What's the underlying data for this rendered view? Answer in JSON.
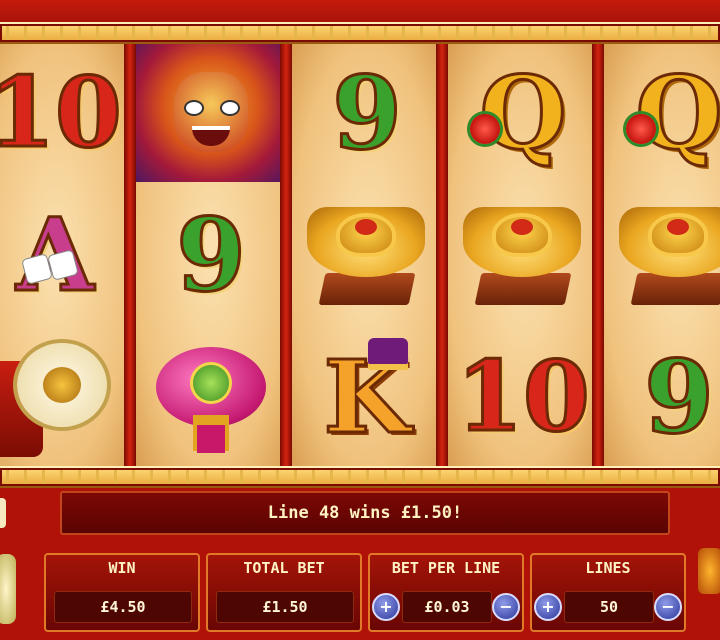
{
  "reels": [
    {
      "id": "reel-1",
      "symbols": [
        "10",
        "A",
        "drum"
      ]
    },
    {
      "id": "reel-2",
      "symbols": [
        "dragon",
        "9",
        "lantern"
      ]
    },
    {
      "id": "reel-3",
      "symbols": [
        "9",
        "gold-ingot",
        "K"
      ]
    },
    {
      "id": "reel-4",
      "symbols": [
        "Q",
        "gold-ingot",
        "10"
      ]
    },
    {
      "id": "reel-5",
      "symbols": [
        "Q",
        "gold-ingot",
        "9"
      ]
    }
  ],
  "symbol_text": {
    "r1_top": "10",
    "r1_mid": "A",
    "r2_mid": "9",
    "r3_top": "9",
    "r3_bot": "K",
    "r4_top": "Q",
    "r4_bot": "10",
    "r5_top": "Q",
    "r5_bot": "9"
  },
  "message": "Line 48 wins £1.50!",
  "panels": {
    "win": {
      "label": "WIN",
      "value": "£4.50"
    },
    "total_bet": {
      "label": "TOTAL BET",
      "value": "£1.50"
    },
    "bet_per_line": {
      "label": "BET PER LINE",
      "value": "£0.03",
      "minus": "−",
      "plus": "+"
    },
    "lines": {
      "label": "LINES",
      "value": "50",
      "minus": "−",
      "plus": "+"
    }
  },
  "colors": {
    "frame_red": "#b01208",
    "gold": "#f2b21e",
    "panel_text": "#fff3c6"
  },
  "icons": [
    "dice-icon",
    "flower-icon",
    "crown-icon",
    "minus-icon",
    "plus-icon"
  ]
}
